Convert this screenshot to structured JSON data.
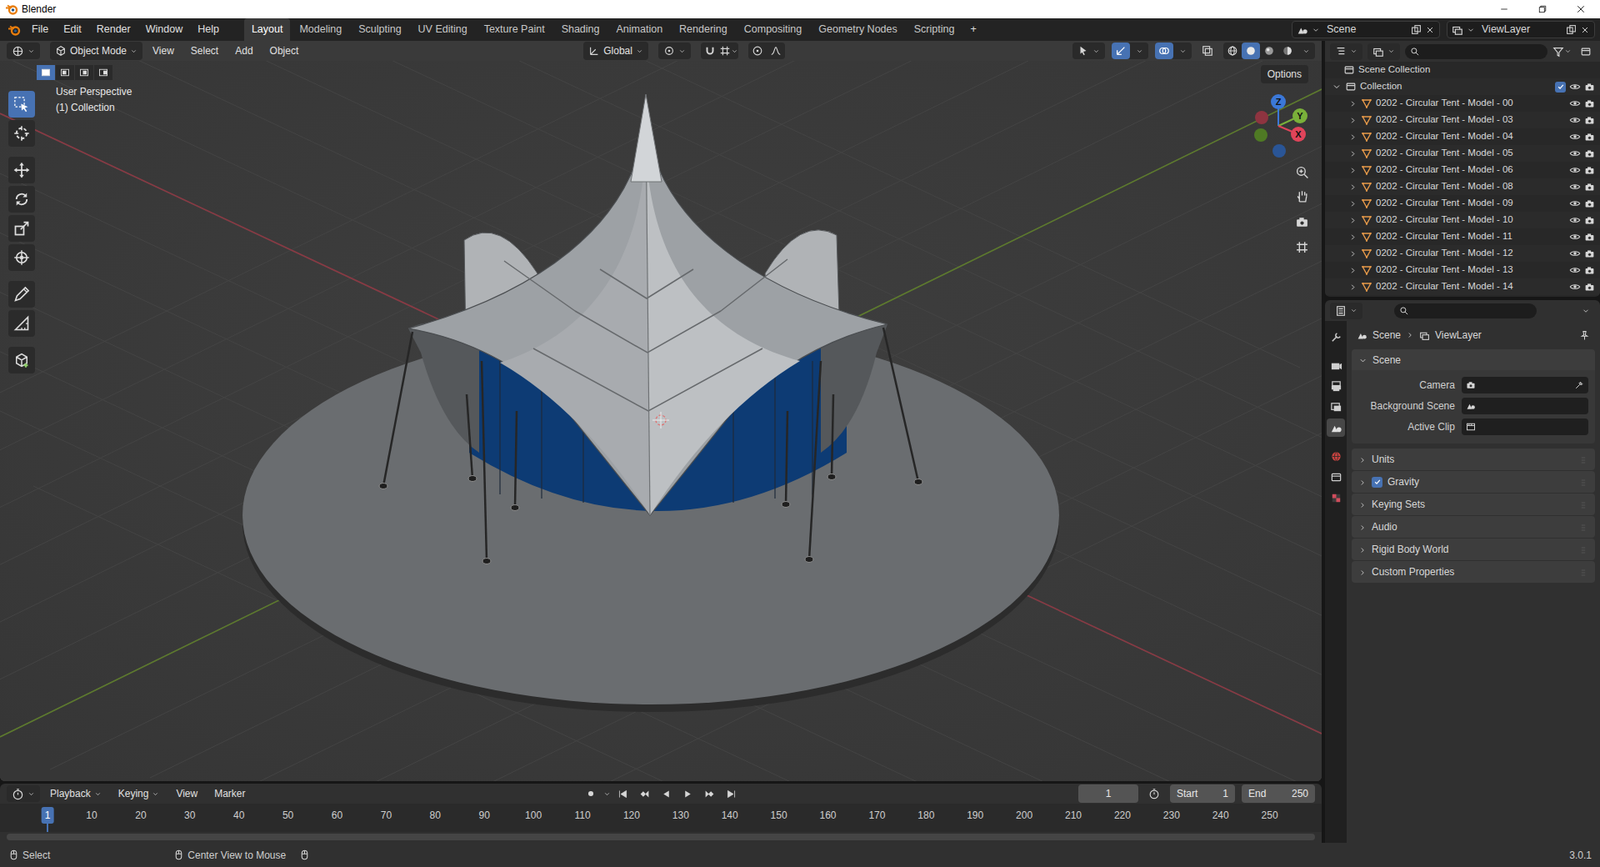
{
  "window": {
    "title": "Blender"
  },
  "menu": [
    "File",
    "Edit",
    "Render",
    "Window",
    "Help"
  ],
  "workspaces": [
    {
      "label": "Layout",
      "selected": true
    },
    {
      "label": "Modeling",
      "selected": false
    },
    {
      "label": "Sculpting",
      "selected": false
    },
    {
      "label": "UV Editing",
      "selected": false
    },
    {
      "label": "Texture Paint",
      "selected": false
    },
    {
      "label": "Shading",
      "selected": false
    },
    {
      "label": "Animation",
      "selected": false
    },
    {
      "label": "Rendering",
      "selected": false
    },
    {
      "label": "Compositing",
      "selected": false
    },
    {
      "label": "Geometry Nodes",
      "selected": false
    },
    {
      "label": "Scripting",
      "selected": false
    }
  ],
  "add_workspace": "+",
  "scene": "Scene",
  "view_layer": "ViewLayer",
  "viewport": {
    "mode": "Object Mode",
    "menus": [
      "View",
      "Select",
      "Add",
      "Object"
    ],
    "orientation": "Global",
    "options": "Options",
    "overlay": [
      "User Perspective",
      "(1) Collection"
    ],
    "gizmo_axes": [
      "X",
      "Y",
      "Z"
    ],
    "select_modes": [
      {
        "selected": true
      },
      {
        "selected": false
      },
      {
        "selected": false
      },
      {
        "selected": false
      }
    ],
    "shading": [
      {
        "kind": "wireframe",
        "selected": false
      },
      {
        "kind": "solid",
        "selected": true
      },
      {
        "kind": "material",
        "selected": false
      },
      {
        "kind": "rendered",
        "selected": false
      }
    ],
    "tools": [
      {
        "kind": "select",
        "selected": true
      },
      {
        "kind": "cursor",
        "selected": false
      },
      {
        "kind": "move",
        "selected": false
      },
      {
        "kind": "rotate",
        "selected": false
      },
      {
        "kind": "scale",
        "selected": false
      },
      {
        "kind": "transform",
        "selected": false
      },
      {
        "kind": "annotate",
        "selected": false
      },
      {
        "kind": "measure",
        "selected": false
      },
      {
        "kind": "add",
        "selected": false
      }
    ]
  },
  "outliner": {
    "root": "Scene Collection",
    "collection": {
      "label": "Collection",
      "expanded": true,
      "checked": true,
      "visible": true
    },
    "items": [
      {
        "label": "0202 - Circular Tent - Model - 00",
        "visible": true
      },
      {
        "label": "0202 - Circular Tent - Model - 03",
        "visible": true
      },
      {
        "label": "0202 - Circular Tent - Model - 04",
        "visible": true
      },
      {
        "label": "0202 - Circular Tent - Model - 05",
        "visible": true
      },
      {
        "label": "0202 - Circular Tent - Model - 06",
        "visible": true
      },
      {
        "label": "0202 - Circular Tent - Model - 08",
        "visible": true
      },
      {
        "label": "0202 - Circular Tent - Model - 09",
        "visible": true
      },
      {
        "label": "0202 - Circular Tent - Model - 10",
        "visible": true
      },
      {
        "label": "0202 - Circular Tent - Model - 11",
        "visible": true
      },
      {
        "label": "0202 - Circular Tent - Model - 12",
        "visible": true
      },
      {
        "label": "0202 - Circular Tent - Model - 13",
        "visible": true
      },
      {
        "label": "0202 - Circular Tent - Model - 14",
        "visible": true
      }
    ]
  },
  "properties": {
    "tabs": [
      {
        "kind": "tool",
        "selected": false
      },
      {
        "kind": "render",
        "selected": false
      },
      {
        "kind": "output",
        "selected": false
      },
      {
        "kind": "viewlayer",
        "selected": false
      },
      {
        "kind": "scene",
        "selected": true
      },
      {
        "kind": "world",
        "selected": false
      },
      {
        "kind": "collection",
        "selected": false
      },
      {
        "kind": "texture",
        "selected": false
      }
    ],
    "breadcrumb": [
      "Scene",
      "ViewLayer"
    ],
    "panel": {
      "label": "Scene",
      "expanded": true
    },
    "fields": [
      {
        "label": "Camera"
      },
      {
        "label": "Background Scene"
      },
      {
        "label": "Active Clip"
      }
    ],
    "subpanels": [
      {
        "label": "Units",
        "kind": "plain",
        "expanded": false
      },
      {
        "label": "Gravity",
        "kind": "checkbox",
        "checked": true,
        "expanded": false
      },
      {
        "label": "Keying Sets",
        "kind": "plain",
        "expanded": false
      },
      {
        "label": "Audio",
        "kind": "plain",
        "expanded": false
      },
      {
        "label": "Rigid Body World",
        "kind": "plain",
        "expanded": false
      },
      {
        "label": "Custom Properties",
        "kind": "plain",
        "expanded": false
      }
    ]
  },
  "timeline": {
    "menus": [
      "Playback",
      "Keying",
      "View",
      "Marker"
    ],
    "frame": "1",
    "start_label": "Start",
    "start": "1",
    "end_label": "End",
    "end": "250",
    "ticks": [
      {
        "label": "1",
        "selected": true
      },
      {
        "label": "10",
        "selected": false
      },
      {
        "label": "20",
        "selected": false
      },
      {
        "label": "30",
        "selected": false
      },
      {
        "label": "40",
        "selected": false
      },
      {
        "label": "50",
        "selected": false
      },
      {
        "label": "60",
        "selected": false
      },
      {
        "label": "70",
        "selected": false
      },
      {
        "label": "80",
        "selected": false
      },
      {
        "label": "90",
        "selected": false
      },
      {
        "label": "100",
        "selected": false
      },
      {
        "label": "110",
        "selected": false
      },
      {
        "label": "120",
        "selected": false
      },
      {
        "label": "130",
        "selected": false
      },
      {
        "label": "140",
        "selected": false
      },
      {
        "label": "150",
        "selected": false
      },
      {
        "label": "160",
        "selected": false
      },
      {
        "label": "170",
        "selected": false
      },
      {
        "label": "180",
        "selected": false
      },
      {
        "label": "190",
        "selected": false
      },
      {
        "label": "200",
        "selected": false
      },
      {
        "label": "210",
        "selected": false
      },
      {
        "label": "220",
        "selected": false
      },
      {
        "label": "230",
        "selected": false
      },
      {
        "label": "240",
        "selected": false
      },
      {
        "label": "250",
        "selected": false
      }
    ]
  },
  "status": {
    "items": [
      "Select",
      "Center View to Mouse"
    ],
    "version": "3.0.1"
  }
}
